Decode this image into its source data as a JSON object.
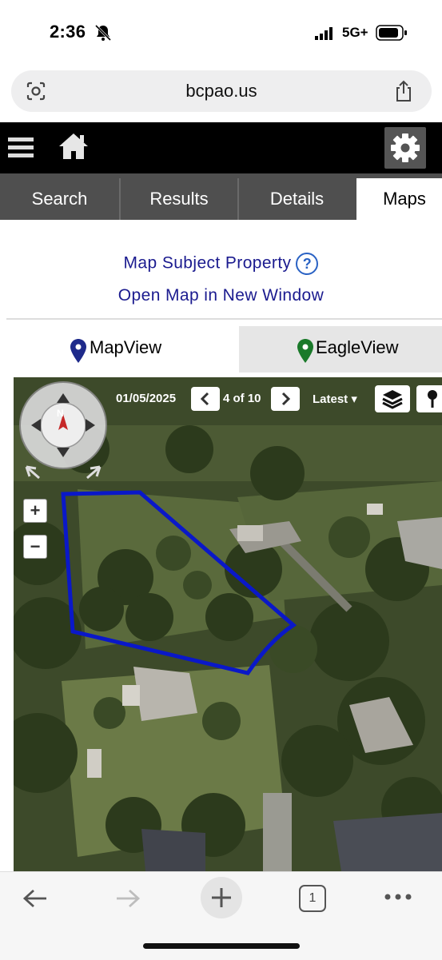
{
  "status_bar": {
    "time": "2:36",
    "network": "5G+"
  },
  "browser": {
    "url": "bcpao.us",
    "open_tabs_count": "1"
  },
  "site_nav": {
    "tabs": [
      {
        "label": "Search"
      },
      {
        "label": "Results"
      },
      {
        "label": "Details"
      },
      {
        "label": "Maps",
        "active": true
      }
    ]
  },
  "links": {
    "map_subject": "Map Subject Property",
    "help_glyph": "?",
    "open_new_window": "Open Map in New Window"
  },
  "map_tabs": {
    "mapview": "MapView",
    "eagleview": "EagleView",
    "active": "eagleview"
  },
  "map_toolbar": {
    "date": "01/05/2025",
    "pager": "4 of 10",
    "latest": "Latest ▾",
    "zoom_in": "+",
    "zoom_out": "−",
    "compass_north": "N"
  },
  "colors": {
    "accent_link": "#1b1b8f",
    "header_bg": "#000000",
    "tab_bg": "#4f4f4f",
    "mapview_pin": "#1e2a8a",
    "eagleview_pin": "#1a7a2a",
    "parcel_outline": "#0a18c8"
  },
  "icons": [
    "bell-slash-icon",
    "signal-icon",
    "battery-icon",
    "lens-icon",
    "share-icon",
    "menu-icon",
    "home-icon",
    "gear-icon",
    "pin-icon",
    "layers-icon",
    "back-arrow-icon",
    "forward-arrow-icon",
    "plus-icon",
    "more-icon"
  ]
}
